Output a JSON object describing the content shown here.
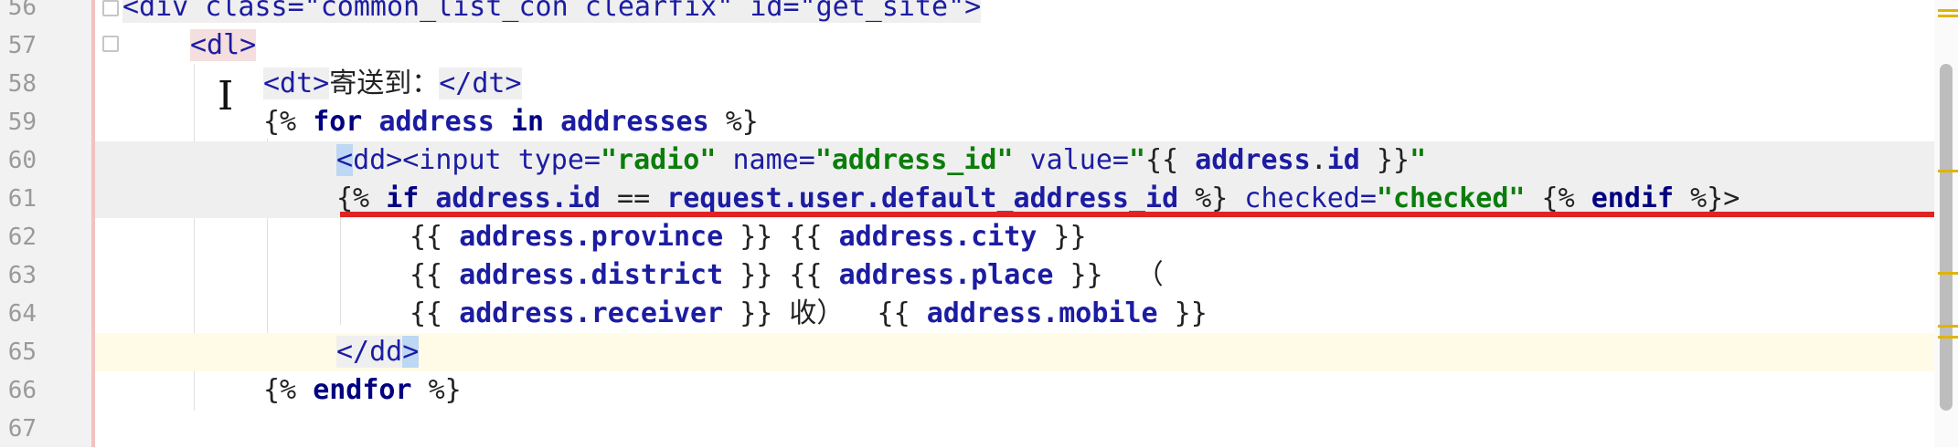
{
  "gutter": {
    "line_numbers": [
      "56",
      "57",
      "58",
      "59",
      "60",
      "61",
      "62",
      "63",
      "64",
      "65",
      "66",
      "67"
    ]
  },
  "code": {
    "l56": {
      "a": "<div class=\"common_list_con clearfix\" id=\"get_site\">"
    },
    "l57": {
      "tag": "<dl>"
    },
    "l58": {
      "open": "<dt>",
      "text": "寄送到：",
      "close": "</dt>"
    },
    "l59": {
      "p1": "{% ",
      "for": "for",
      "p2": " ",
      "address": "address",
      "p3": " in ",
      "addresses": "addresses",
      "p4": " %}"
    },
    "l60": {
      "lt": "<",
      "dd": "dd>",
      "input": "<input ",
      "type_attr": "type=",
      "type_val": "\"radio\"",
      "sp1": " ",
      "name_attr": "name=",
      "name_val": "\"address_id\"",
      "sp2": " ",
      "value_attr": "value=",
      "value_q": "\"",
      "tpl_open": "{{ ",
      "var": "address",
      "dot": ".",
      "id": "id",
      "tpl_close": " }}",
      "value_q2": "\""
    },
    "l61": {
      "p1": "{% ",
      "if": "if",
      "sp": " ",
      "v1": "address.id",
      "eq": " == ",
      "v2": "request.user.default_address_id",
      "p2": " %}",
      "sp2": " ",
      "checked_attr": "checked=",
      "checked_val": "\"checked\"",
      "p3": " {% ",
      "endif": "endif",
      "p4": " %}>"
    },
    "l62": {
      "a": "{{ ",
      "b": "address.province",
      "c": " }} {{ ",
      "d": "address.city",
      "e": " }}"
    },
    "l63": {
      "a": "{{ ",
      "b": "address.district",
      "c": " }} {{ ",
      "d": "address.place",
      "e": " }}  （"
    },
    "l64": {
      "a": "{{ ",
      "b": "address.receiver",
      "c": " }} 收）  {{ ",
      "d": "address.mobile",
      "e": " }}"
    },
    "l65": {
      "close": "</dd",
      "gt": ">"
    },
    "l66": {
      "p1": "{% ",
      "endfor": "endfor",
      "p2": " %}"
    }
  },
  "colors": {
    "underline": "#e02424",
    "current_line": "#fffbe6"
  }
}
